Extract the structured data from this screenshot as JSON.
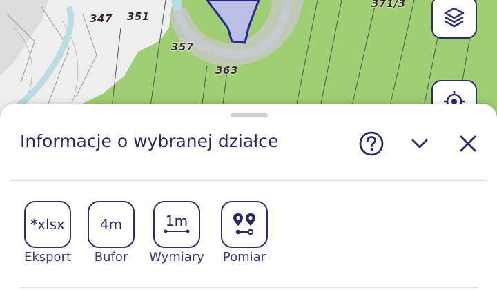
{
  "map": {
    "parcel_labels": [
      "347",
      "351",
      "357",
      "363",
      "371/3"
    ],
    "colors": {
      "green": "#9ecf72",
      "water": "#b8dde2",
      "highlight": "#b9bfe6",
      "outline": "#2a2890"
    },
    "buttons": [
      {
        "name": "layers",
        "icon": "layers-icon"
      },
      {
        "name": "locate",
        "icon": "crosshair-icon"
      }
    ]
  },
  "panel": {
    "title": "Informacje o wybranej działce",
    "header_icons": [
      "help-icon",
      "chevron-down-icon",
      "close-icon"
    ],
    "tools": [
      {
        "id": "eksport",
        "icon_text": "*xlsx",
        "label": "Eksport"
      },
      {
        "id": "bufor",
        "icon_text": "4m",
        "label": "Bufor"
      },
      {
        "id": "wymiary",
        "icon_text": "1m",
        "label": "Wymiary"
      },
      {
        "id": "pomiar",
        "icon": "pins-icon",
        "label": "Pomiar"
      }
    ]
  },
  "colors": {
    "accent": "#2f2d6b",
    "text": "#2a2864"
  }
}
